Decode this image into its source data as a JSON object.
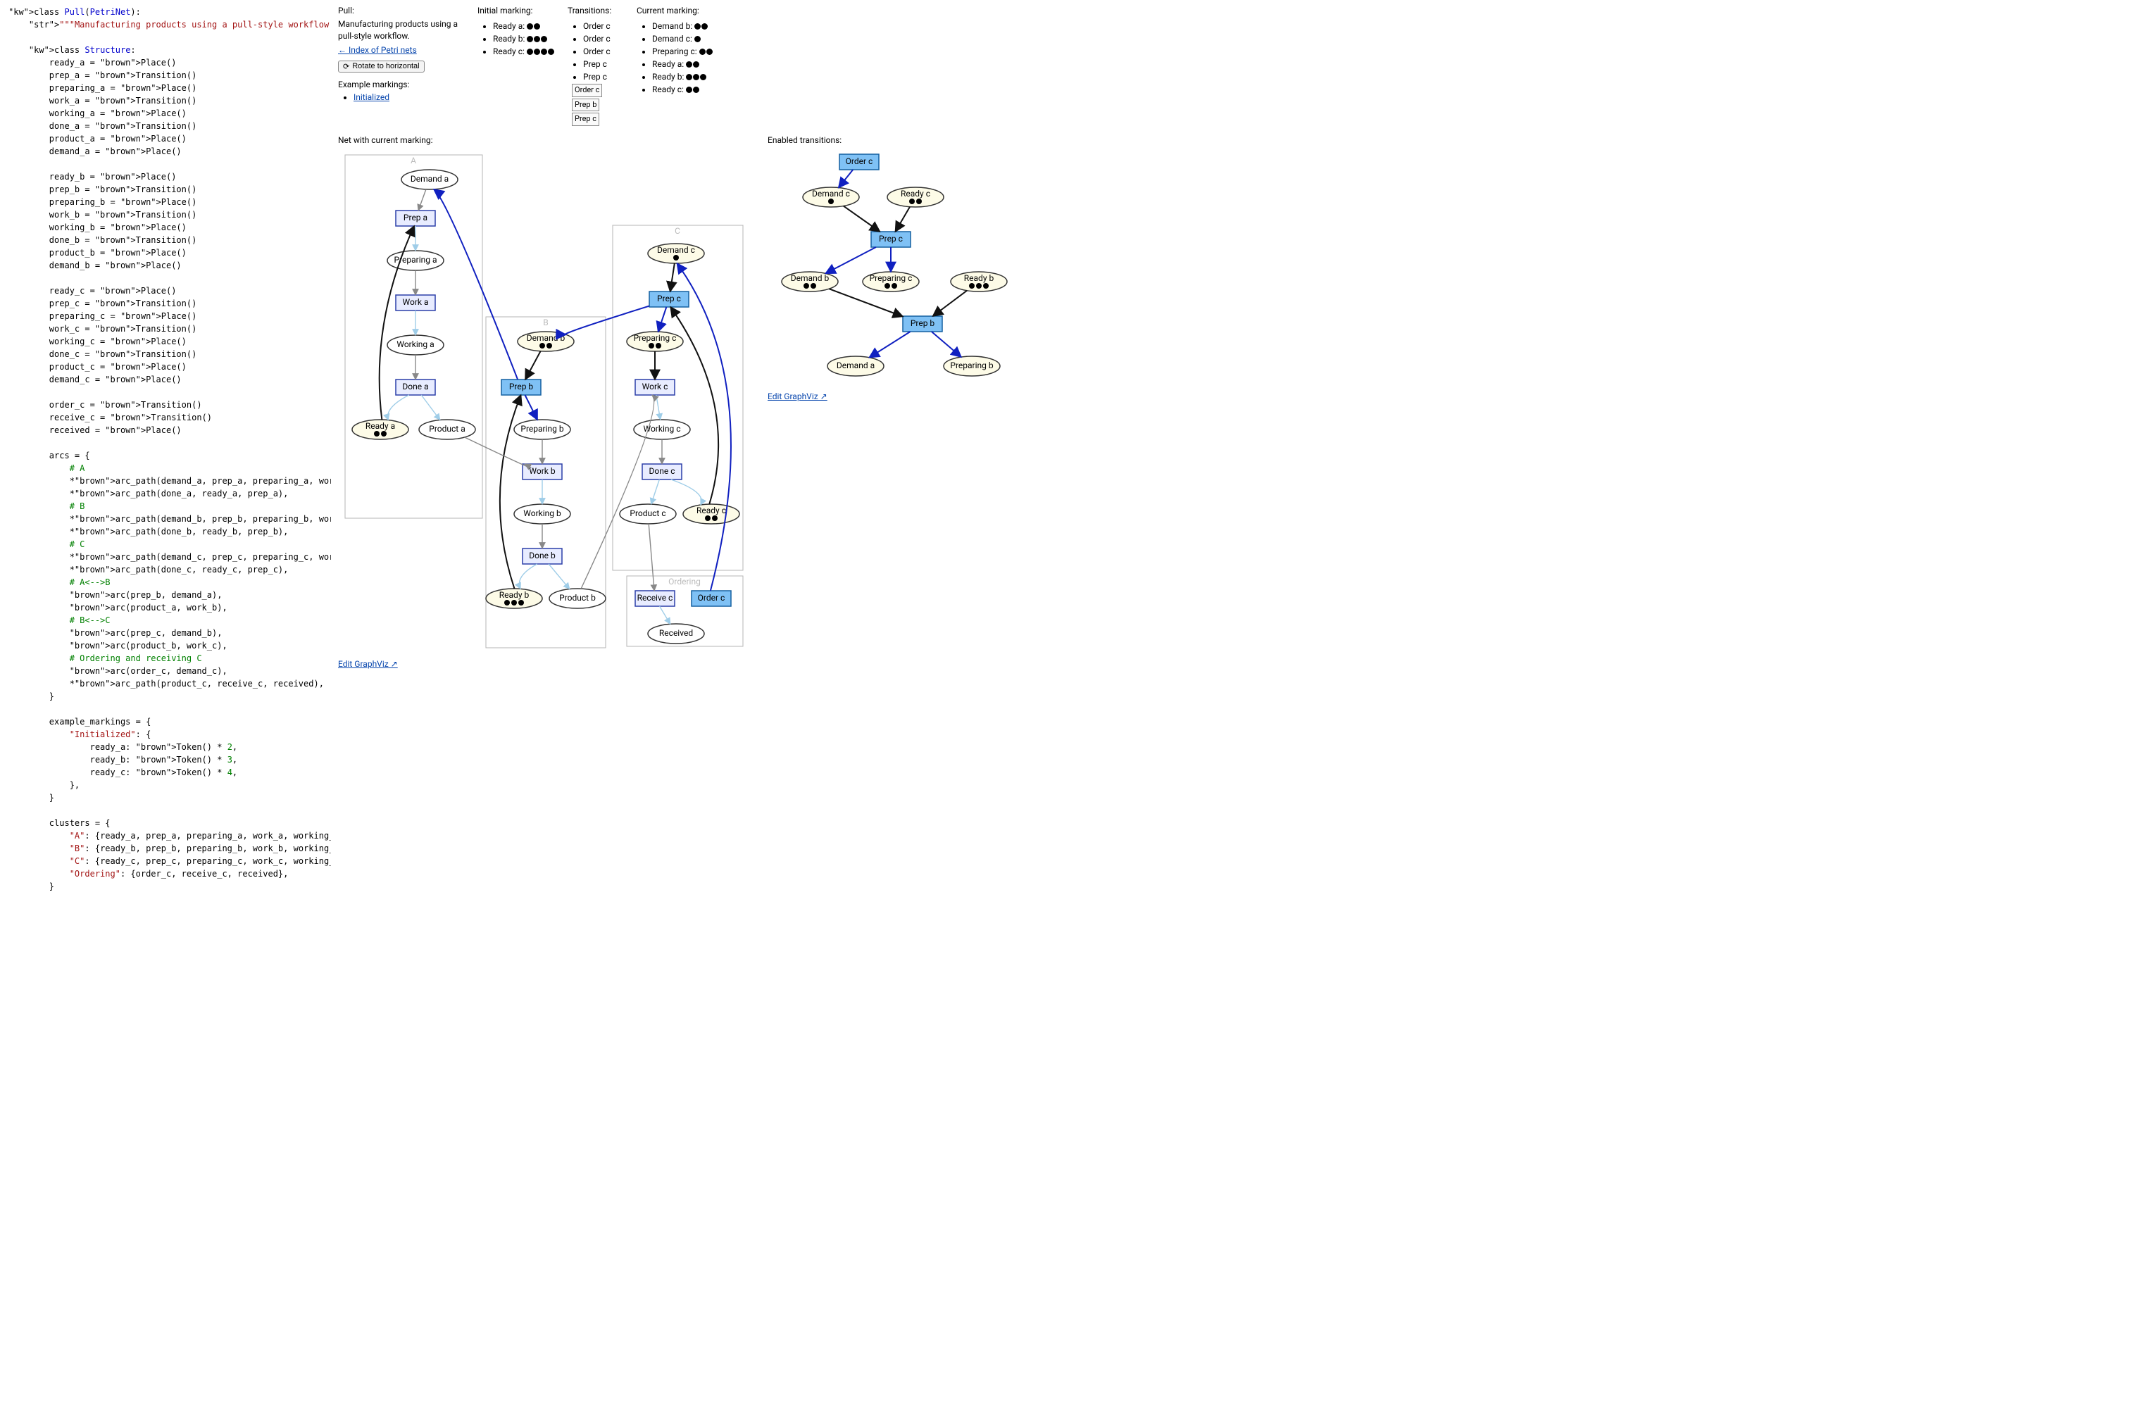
{
  "title": "Pull",
  "description": "Manufacturing products using a pull-style workflow.",
  "nav": {
    "index_link": "← Index of Petri nets",
    "rotate_button": "Rotate to horizontal",
    "example_markings_heading": "Example markings:",
    "example_markings": [
      "Initialized"
    ]
  },
  "headings": {
    "pull": "Pull:",
    "initial": "Initial marking:",
    "transitions": "Transitions:",
    "current": "Current marking:",
    "net": "Net with current marking:",
    "enabled": "Enabled transitions:",
    "edit": "Edit GraphViz  ↗"
  },
  "initial_marking": [
    {
      "place": "Ready a",
      "tokens": 2
    },
    {
      "place": "Ready b",
      "tokens": 3
    },
    {
      "place": "Ready c",
      "tokens": 4
    }
  ],
  "transitions_history": [
    {
      "name": "Order c",
      "box": false
    },
    {
      "name": "Order c",
      "box": false
    },
    {
      "name": "Order c",
      "box": false
    },
    {
      "name": "Prep c",
      "box": false
    },
    {
      "name": "Prep c",
      "box": false
    },
    {
      "name": "Order c",
      "box": true
    },
    {
      "name": "Prep b",
      "box": true
    },
    {
      "name": "Prep c",
      "box": true
    }
  ],
  "current_marking": [
    {
      "place": "Demand b",
      "tokens": 2
    },
    {
      "place": "Demand c",
      "tokens": 1
    },
    {
      "place": "Preparing c",
      "tokens": 2
    },
    {
      "place": "Ready a",
      "tokens": 2
    },
    {
      "place": "Ready b",
      "tokens": 3
    },
    {
      "place": "Ready c",
      "tokens": 2
    }
  ],
  "chart_data": [
    {
      "title": "Net with current marking",
      "type": "petri_net",
      "clusters": {
        "A": [
          "ready_a",
          "prep_a",
          "preparing_a",
          "work_a",
          "working_a",
          "done_a",
          "product_a",
          "demand_a"
        ],
        "B": [
          "ready_b",
          "prep_b",
          "preparing_b",
          "work_b",
          "working_b",
          "done_b",
          "product_b",
          "demand_b"
        ],
        "C": [
          "ready_c",
          "prep_c",
          "preparing_c",
          "work_c",
          "working_c",
          "done_c",
          "product_c",
          "demand_c"
        ],
        "Ordering": [
          "order_c",
          "receive_c",
          "received"
        ]
      },
      "places": {
        "demand_a": {
          "label": "Demand a",
          "tokens": 0
        },
        "preparing_a": {
          "label": "Preparing a",
          "tokens": 0
        },
        "working_a": {
          "label": "Working a",
          "tokens": 0
        },
        "ready_a": {
          "label": "Ready a",
          "tokens": 2
        },
        "product_a": {
          "label": "Product a",
          "tokens": 0
        },
        "demand_b": {
          "label": "Demand b",
          "tokens": 2
        },
        "preparing_b": {
          "label": "Preparing b",
          "tokens": 0
        },
        "working_b": {
          "label": "Working b",
          "tokens": 0
        },
        "ready_b": {
          "label": "Ready b",
          "tokens": 3
        },
        "product_b": {
          "label": "Product b",
          "tokens": 0
        },
        "demand_c": {
          "label": "Demand c",
          "tokens": 1
        },
        "preparing_c": {
          "label": "Preparing c",
          "tokens": 2
        },
        "working_c": {
          "label": "Working c",
          "tokens": 0
        },
        "ready_c": {
          "label": "Ready c",
          "tokens": 2
        },
        "product_c": {
          "label": "Product c",
          "tokens": 0
        },
        "received": {
          "label": "Received",
          "tokens": 0
        }
      },
      "transitions": {
        "prep_a": {
          "label": "Prep a",
          "enabled": false
        },
        "work_a": {
          "label": "Work a",
          "enabled": false
        },
        "done_a": {
          "label": "Done a",
          "enabled": false
        },
        "prep_b": {
          "label": "Prep b",
          "enabled": true
        },
        "work_b": {
          "label": "Work b",
          "enabled": false
        },
        "done_b": {
          "label": "Done b",
          "enabled": false
        },
        "prep_c": {
          "label": "Prep c",
          "enabled": true
        },
        "work_c": {
          "label": "Work c",
          "enabled": false
        },
        "done_c": {
          "label": "Done c",
          "enabled": false
        },
        "order_c": {
          "label": "Order c",
          "enabled": true
        },
        "receive_c": {
          "label": "Receive c",
          "enabled": false
        }
      },
      "arcs": [
        [
          "demand_a",
          "prep_a"
        ],
        [
          "prep_a",
          "preparing_a"
        ],
        [
          "preparing_a",
          "work_a"
        ],
        [
          "work_a",
          "working_a"
        ],
        [
          "working_a",
          "done_a"
        ],
        [
          "done_a",
          "product_a"
        ],
        [
          "done_a",
          "ready_a"
        ],
        [
          "ready_a",
          "prep_a"
        ],
        [
          "demand_b",
          "prep_b"
        ],
        [
          "prep_b",
          "preparing_b"
        ],
        [
          "preparing_b",
          "work_b"
        ],
        [
          "work_b",
          "working_b"
        ],
        [
          "working_b",
          "done_b"
        ],
        [
          "done_b",
          "product_b"
        ],
        [
          "done_b",
          "ready_b"
        ],
        [
          "ready_b",
          "prep_b"
        ],
        [
          "demand_c",
          "prep_c"
        ],
        [
          "prep_c",
          "preparing_c"
        ],
        [
          "preparing_c",
          "work_c"
        ],
        [
          "work_c",
          "working_c"
        ],
        [
          "working_c",
          "done_c"
        ],
        [
          "done_c",
          "product_c"
        ],
        [
          "done_c",
          "ready_c"
        ],
        [
          "ready_c",
          "prep_c"
        ],
        [
          "prep_b",
          "demand_a"
        ],
        [
          "product_a",
          "work_b"
        ],
        [
          "prep_c",
          "demand_b"
        ],
        [
          "product_b",
          "work_c"
        ],
        [
          "order_c",
          "demand_c"
        ],
        [
          "product_c",
          "receive_c"
        ],
        [
          "receive_c",
          "received"
        ]
      ]
    },
    {
      "title": "Enabled transitions",
      "type": "reachability_tree",
      "root": "Order c",
      "nodes": {
        "order_c": {
          "label": "Order c",
          "kind": "transition",
          "enabled": true
        },
        "demand_c": {
          "label": "Demand c",
          "kind": "place",
          "tokens": 1
        },
        "ready_c": {
          "label": "Ready c",
          "kind": "place",
          "tokens": 2
        },
        "prep_c": {
          "label": "Prep c",
          "kind": "transition",
          "enabled": true
        },
        "demand_b": {
          "label": "Demand b",
          "kind": "place",
          "tokens": 2
        },
        "preparing_c": {
          "label": "Preparing c",
          "kind": "place",
          "tokens": 2
        },
        "ready_b": {
          "label": "Ready b",
          "kind": "place",
          "tokens": 3
        },
        "prep_b": {
          "label": "Prep b",
          "kind": "transition",
          "enabled": true
        },
        "demand_a": {
          "label": "Demand a",
          "kind": "place",
          "tokens": 0
        },
        "preparing_b": {
          "label": "Preparing b",
          "kind": "place",
          "tokens": 0
        }
      },
      "edges": [
        [
          "order_c",
          "demand_c"
        ],
        [
          "demand_c",
          "prep_c"
        ],
        [
          "ready_c",
          "prep_c"
        ],
        [
          "prep_c",
          "demand_b"
        ],
        [
          "prep_c",
          "preparing_c"
        ],
        [
          "demand_b",
          "prep_b"
        ],
        [
          "ready_b",
          "prep_b"
        ],
        [
          "prep_b",
          "demand_a"
        ],
        [
          "prep_b",
          "preparing_b"
        ]
      ]
    }
  ],
  "code": {
    "lines": [
      "class Pull(PetriNet):",
      "    \"\"\"Manufacturing products using a pull-style workflow.\"\"\"",
      "",
      "    class Structure:",
      "        ready_a = Place()",
      "        prep_a = Transition()",
      "        preparing_a = Place()",
      "        work_a = Transition()",
      "        working_a = Place()",
      "        done_a = Transition()",
      "        product_a = Place()",
      "        demand_a = Place()",
      "",
      "        ready_b = Place()",
      "        prep_b = Transition()",
      "        preparing_b = Place()",
      "        work_b = Transition()",
      "        working_b = Place()",
      "        done_b = Transition()",
      "        product_b = Place()",
      "        demand_b = Place()",
      "",
      "        ready_c = Place()",
      "        prep_c = Transition()",
      "        preparing_c = Place()",
      "        work_c = Transition()",
      "        working_c = Place()",
      "        done_c = Transition()",
      "        product_c = Place()",
      "        demand_c = Place()",
      "",
      "        order_c = Transition()",
      "        receive_c = Transition()",
      "        received = Place()",
      "",
      "        arcs = {",
      "            # A",
      "            *arc_path(demand_a, prep_a, preparing_a, work_a, working_a, done_a, product_a),",
      "            *arc_path(done_a, ready_a, prep_a),",
      "            # B",
      "            *arc_path(demand_b, prep_b, preparing_b, work_b, working_b, done_b, product_b),",
      "            *arc_path(done_b, ready_b, prep_b),",
      "            # C",
      "            *arc_path(demand_c, prep_c, preparing_c, work_c, working_c, done_c, product_c),",
      "            *arc_path(done_c, ready_c, prep_c),",
      "            # A<-->B",
      "            arc(prep_b, demand_a),",
      "            arc(product_a, work_b),",
      "            # B<-->C",
      "            arc(prep_c, demand_b),",
      "            arc(product_b, work_c),",
      "            # Ordering and receiving C",
      "            arc(order_c, demand_c),",
      "            *arc_path(product_c, receive_c, received),",
      "        }",
      "",
      "        example_markings = {",
      "            \"Initialized\": {",
      "                ready_a: Token() * 2,",
      "                ready_b: Token() * 3,",
      "                ready_c: Token() * 4,",
      "            },",
      "        }",
      "",
      "        clusters = {",
      "            \"A\": {ready_a, prep_a, preparing_a, work_a, working_a, done_a, product_a, demand_a},",
      "            \"B\": {ready_b, prep_b, preparing_b, work_b, working_b, done_b, product_b, demand_b},",
      "            \"C\": {ready_c, prep_c, preparing_c, work_c, working_c, done_c, product_c, demand_c},",
      "            \"Ordering\": {order_c, receive_c, received},",
      "        }"
    ]
  }
}
